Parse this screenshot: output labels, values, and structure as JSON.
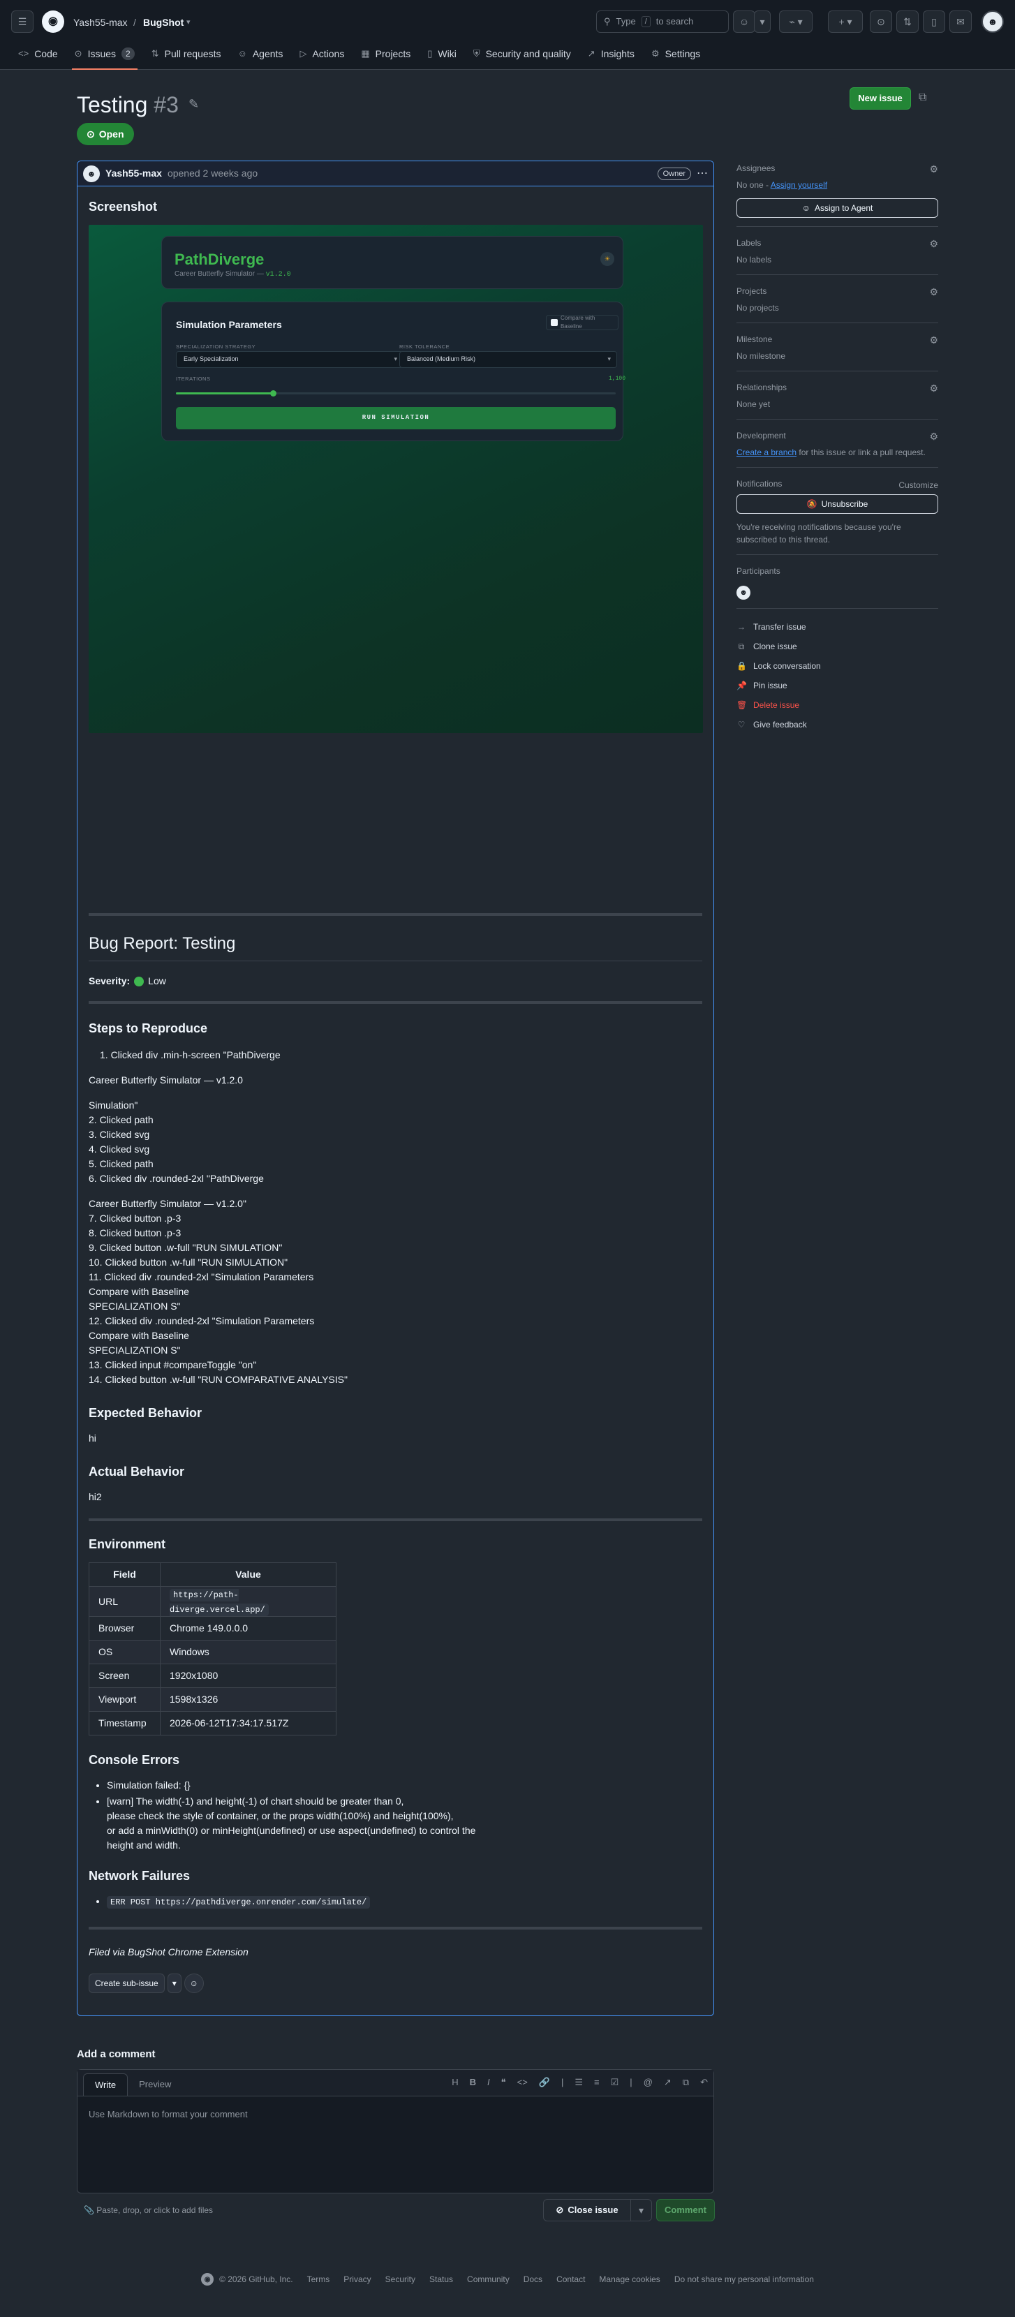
{
  "header": {
    "owner": "Yash55-max",
    "separator": "/",
    "repo": "BugShot",
    "search_pre": "Type",
    "search_key": "/",
    "search_post": "to search"
  },
  "tabs": [
    {
      "icon": "<>",
      "label": "Code"
    },
    {
      "icon": "⊙",
      "label": "Issues",
      "count": "2"
    },
    {
      "icon": "⇅",
      "label": "Pull requests"
    },
    {
      "icon": "☺",
      "label": "Agents"
    },
    {
      "icon": "▷",
      "label": "Actions"
    },
    {
      "icon": "▦",
      "label": "Projects"
    },
    {
      "icon": "▯",
      "label": "Wiki"
    },
    {
      "icon": "⛨",
      "label": "Security and quality"
    },
    {
      "icon": "↗",
      "label": "Insights"
    },
    {
      "icon": "⚙",
      "label": "Settings"
    }
  ],
  "issue": {
    "title": "Testing",
    "number": "#3",
    "state": "Open",
    "new_issue": "New issue"
  },
  "comment": {
    "author": "Yash55-max",
    "meta": "opened 2 weeks ago",
    "owner_badge": "Owner",
    "screenshot_heading": "Screenshot",
    "app": {
      "title": "PathDiverge",
      "subtitle": "Career Butterfly Simulator —",
      "version": "v1.2.0",
      "params_title": "Simulation Parameters",
      "compare_label": "Compare with Baseline",
      "strategy_label": "SPECIALIZATION STRATEGY",
      "strategy_value": "Early Specialization",
      "risk_label": "RISK TOLERANCE",
      "risk_value": "Balanced (Medium Risk)",
      "iterations_label": "ITERATIONS",
      "iterations_value": "1,100",
      "slider_fraction": 0.22,
      "run_button": "RUN SIMULATION"
    },
    "report_title": "Bug Report: Testing",
    "severity_label": "Severity:",
    "severity_value": "Low",
    "steps_heading": "Steps to Reproduce",
    "steps_block1": "1. Clicked div .min-h-screen \"PathDiverge",
    "steps_block2": "Career Butterfly Simulator — v1.2.0",
    "steps_block3": "Simulation\"\n2. Clicked path\n3. Clicked svg\n4. Clicked svg\n5. Clicked path\n6. Clicked div .rounded-2xl \"PathDiverge",
    "steps_block4": "Career Butterfly Simulator — v1.2.0\"\n7. Clicked button .p-3\n8. Clicked button .p-3\n9. Clicked button .w-full \"RUN SIMULATION\"\n10. Clicked button .w-full \"RUN SIMULATION\"\n11. Clicked div .rounded-2xl \"Simulation Parameters\nCompare with Baseline\nSPECIALIZATION S\"\n12. Clicked div .rounded-2xl \"Simulation Parameters\nCompare with Baseline\nSPECIALIZATION S\"\n13. Clicked input #compareToggle \"on\"\n14. Clicked button .w-full \"RUN COMPARATIVE ANALYSIS\"",
    "expected_heading": "Expected Behavior",
    "expected_text": "hi",
    "actual_heading": "Actual Behavior",
    "actual_text": "hi2",
    "env_heading": "Environment",
    "env_cols": [
      "Field",
      "Value"
    ],
    "env_rows": [
      [
        "URL",
        "https://path-diverge.vercel.app/"
      ],
      [
        "Browser",
        "Chrome 149.0.0.0"
      ],
      [
        "OS",
        "Windows"
      ],
      [
        "Screen",
        "1920x1080"
      ],
      [
        "Viewport",
        "1598x1326"
      ],
      [
        "Timestamp",
        "2026-06-12T17:34:17.517Z"
      ]
    ],
    "console_heading": "Console Errors",
    "console_errors": [
      "Simulation failed: {}",
      "[warn] The width(-1) and height(-1) of chart should be greater than 0,\nplease check the style of container, or the props width(100%) and height(100%),\nor add a minWidth(0) or minHeight(undefined) or use aspect(undefined) to control the\nheight and width."
    ],
    "network_heading": "Network Failures",
    "network_failure": "ERR POST https://pathdiverge.onrender.com/simulate/",
    "filed_via": "Filed via BugShot Chrome Extension",
    "create_sub_issue": "Create sub-issue"
  },
  "sidebar": {
    "assignees_label": "Assignees",
    "assignees_none": "No one -",
    "assign_yourself": "Assign yourself",
    "assign_agent": "Assign to Agent",
    "labels_label": "Labels",
    "labels_value": "No labels",
    "projects_label": "Projects",
    "projects_value": "No projects",
    "milestone_label": "Milestone",
    "milestone_value": "No milestone",
    "relationships_label": "Relationships",
    "relationships_value": "None yet",
    "development_label": "Development",
    "create_branch": "Create a branch",
    "development_rest": "for this issue or link a pull request.",
    "notifications_label": "Notifications",
    "customize": "Customize",
    "unsubscribe": "Unsubscribe",
    "notif_reason": "You're receiving notifications because you're subscribed to this thread.",
    "participants_label": "Participants",
    "actions": [
      {
        "icon": "→",
        "label": "Transfer issue"
      },
      {
        "icon": "⧉",
        "label": "Clone issue"
      },
      {
        "icon": "🔒",
        "label": "Lock conversation"
      },
      {
        "icon": "📌",
        "label": "Pin issue"
      },
      {
        "icon": "🗑",
        "label": "Delete issue"
      },
      {
        "icon": "♡",
        "label": "Give feedback"
      }
    ]
  },
  "composer": {
    "heading": "Add a comment",
    "tab_write": "Write",
    "tab_preview": "Preview",
    "placeholder": "Use Markdown to format your comment",
    "attach": "Paste, drop, or click to add files",
    "close_issue": "Close issue",
    "comment_button": "Comment"
  },
  "footer": {
    "copyright": "© 2026 GitHub, Inc.",
    "links": [
      "Terms",
      "Privacy",
      "Security",
      "Status",
      "Community",
      "Docs",
      "Contact",
      "Manage cookies",
      "Do not share my personal information"
    ]
  },
  "colors": {
    "accent": "#4493f8",
    "open": "#238636",
    "danger": "#f85149",
    "app_green": "#3fb950"
  }
}
